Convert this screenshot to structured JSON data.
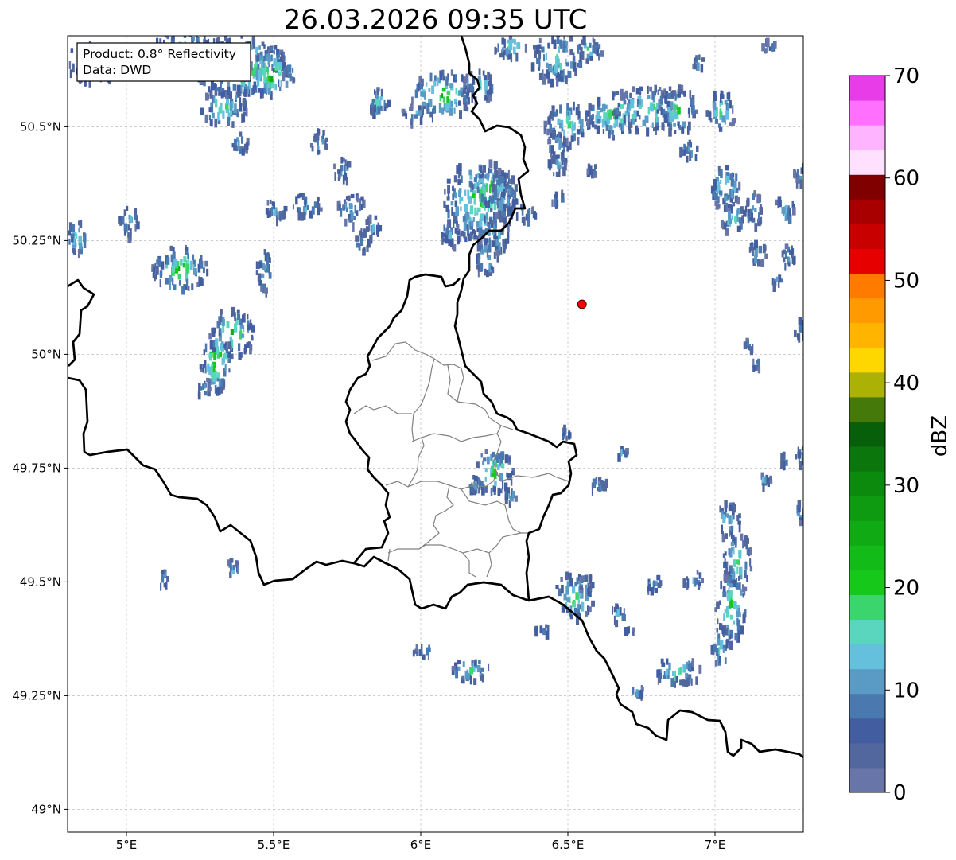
{
  "title": "26.03.2026 09:35 UTC",
  "info": {
    "product_line": "Product: 0.8° Reflectivity",
    "data_line": "Data: DWD"
  },
  "map": {
    "extent": {
      "lon_min": 4.8,
      "lon_max": 7.3,
      "lat_min": 48.95,
      "lat_max": 50.7
    },
    "x_ticks": [
      {
        "lon": 5.0,
        "label": "5°E"
      },
      {
        "lon": 5.5,
        "label": "5.5°E"
      },
      {
        "lon": 6.0,
        "label": "6°E"
      },
      {
        "lon": 6.5,
        "label": "6.5°E"
      },
      {
        "lon": 7.0,
        "label": "7°E"
      }
    ],
    "y_ticks": [
      {
        "lat": 50.5,
        "label": "50.5°N"
      },
      {
        "lat": 50.25,
        "label": "50.25°N"
      },
      {
        "lat": 50.0,
        "label": "50°N"
      },
      {
        "lat": 49.75,
        "label": "49.75°N"
      },
      {
        "lat": 49.5,
        "label": "49.5°N"
      },
      {
        "lat": 49.25,
        "label": "49.25°N"
      },
      {
        "lat": 49.0,
        "label": "49°N"
      }
    ],
    "radar_site": {
      "lon": 6.548,
      "lat": 50.11,
      "color": "#ff0000"
    },
    "grid": true
  },
  "colorbar": {
    "label": "dBZ",
    "min": 0,
    "max": 70,
    "tick_labels": [
      "0",
      "10",
      "20",
      "30",
      "40",
      "50",
      "60",
      "70"
    ],
    "colors": [
      "#6775a8",
      "#53679f",
      "#425da0",
      "#4a79b0",
      "#5a9bc5",
      "#64c0dc",
      "#5bd6be",
      "#3ad56c",
      "#15c81a",
      "#12bb18",
      "#10aa14",
      "#0e9a11",
      "#0b8a0e",
      "#0a760c",
      "#085f09",
      "#457a0a",
      "#acb106",
      "#ffd700",
      "#ffb500",
      "#ff9a00",
      "#ff7b00",
      "#e60000",
      "#c80000",
      "#a80000",
      "#800000",
      "#ffe0ff",
      "#ffb4ff",
      "#ff70ff",
      "#e83ce8"
    ]
  }
}
